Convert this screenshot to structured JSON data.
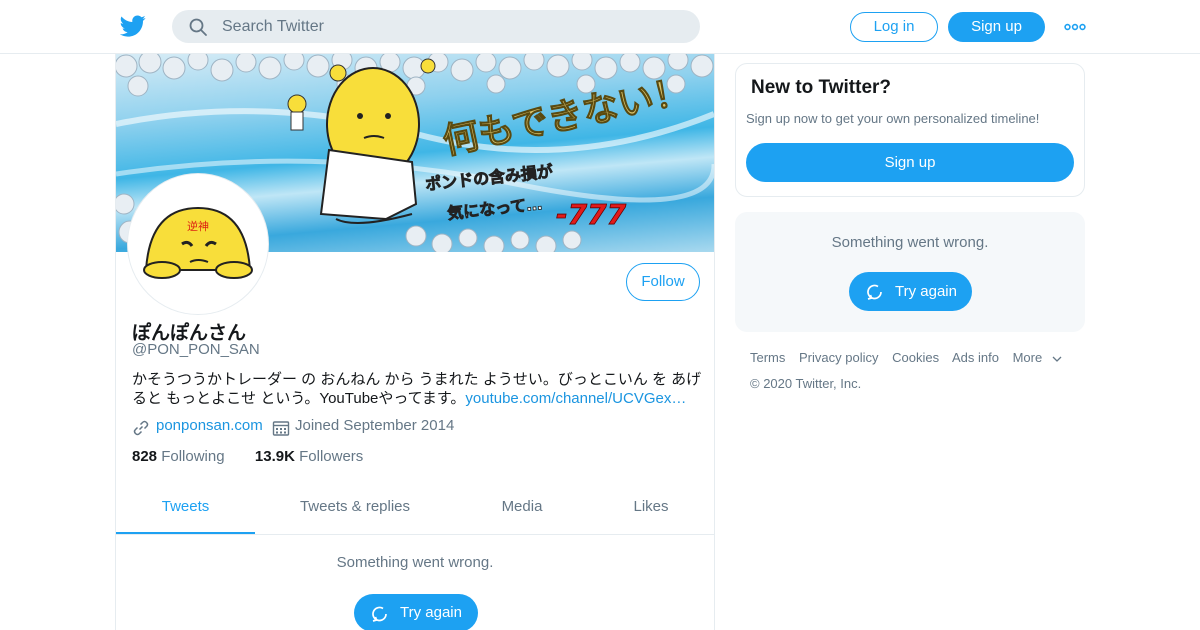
{
  "header": {
    "logo_icon": "twitter-bird-icon",
    "search_placeholder": "Search Twitter",
    "login_label": "Log in",
    "signup_label": "Sign up",
    "more_icon": "more-dots-icon"
  },
  "profile": {
    "display_name": "ぽんぽんさん",
    "handle": "@PON_PON_SAN",
    "bio_text": "かそうつうかトレーダー の おんねん から うまれた ようせい。びっとこいん を あげると もっとよこせ という。YouTubeやってます。",
    "bio_link": "youtube.com/channel/UCVGex…",
    "website": "ponponsan.com",
    "joined": "Joined September 2014",
    "following_count": "828",
    "following_label": "Following",
    "followers_count": "13.9K",
    "followers_label": "Followers",
    "follow_label": "Follow",
    "banner_text_main": "何もできない！",
    "banner_text_sub1": "ポンドの含み損が",
    "banner_text_sub2": "気になって…",
    "banner_text_num": "-777",
    "avatar_text": "逆神"
  },
  "tabs": [
    {
      "label": "Tweets",
      "active": true
    },
    {
      "label": "Tweets & replies",
      "active": false
    },
    {
      "label": "Media",
      "active": false
    },
    {
      "label": "Likes",
      "active": false
    }
  ],
  "timeline": {
    "error_message": "Something went wrong.",
    "try_again_label": "Try again"
  },
  "sidebar": {
    "new_title": "New to Twitter?",
    "new_subtitle": "Sign up now to get your own personalized timeline!",
    "signup_label": "Sign up",
    "error_message": "Something went wrong.",
    "try_again_label": "Try again"
  },
  "footer": {
    "links": [
      "Terms",
      "Privacy policy",
      "Cookies",
      "Ads info",
      "More"
    ],
    "copyright": "© 2020 Twitter, Inc."
  },
  "colors": {
    "accent": "#1da1f2",
    "link": "#1b95e0",
    "muted": "#657786",
    "border": "#e6ecf0"
  }
}
